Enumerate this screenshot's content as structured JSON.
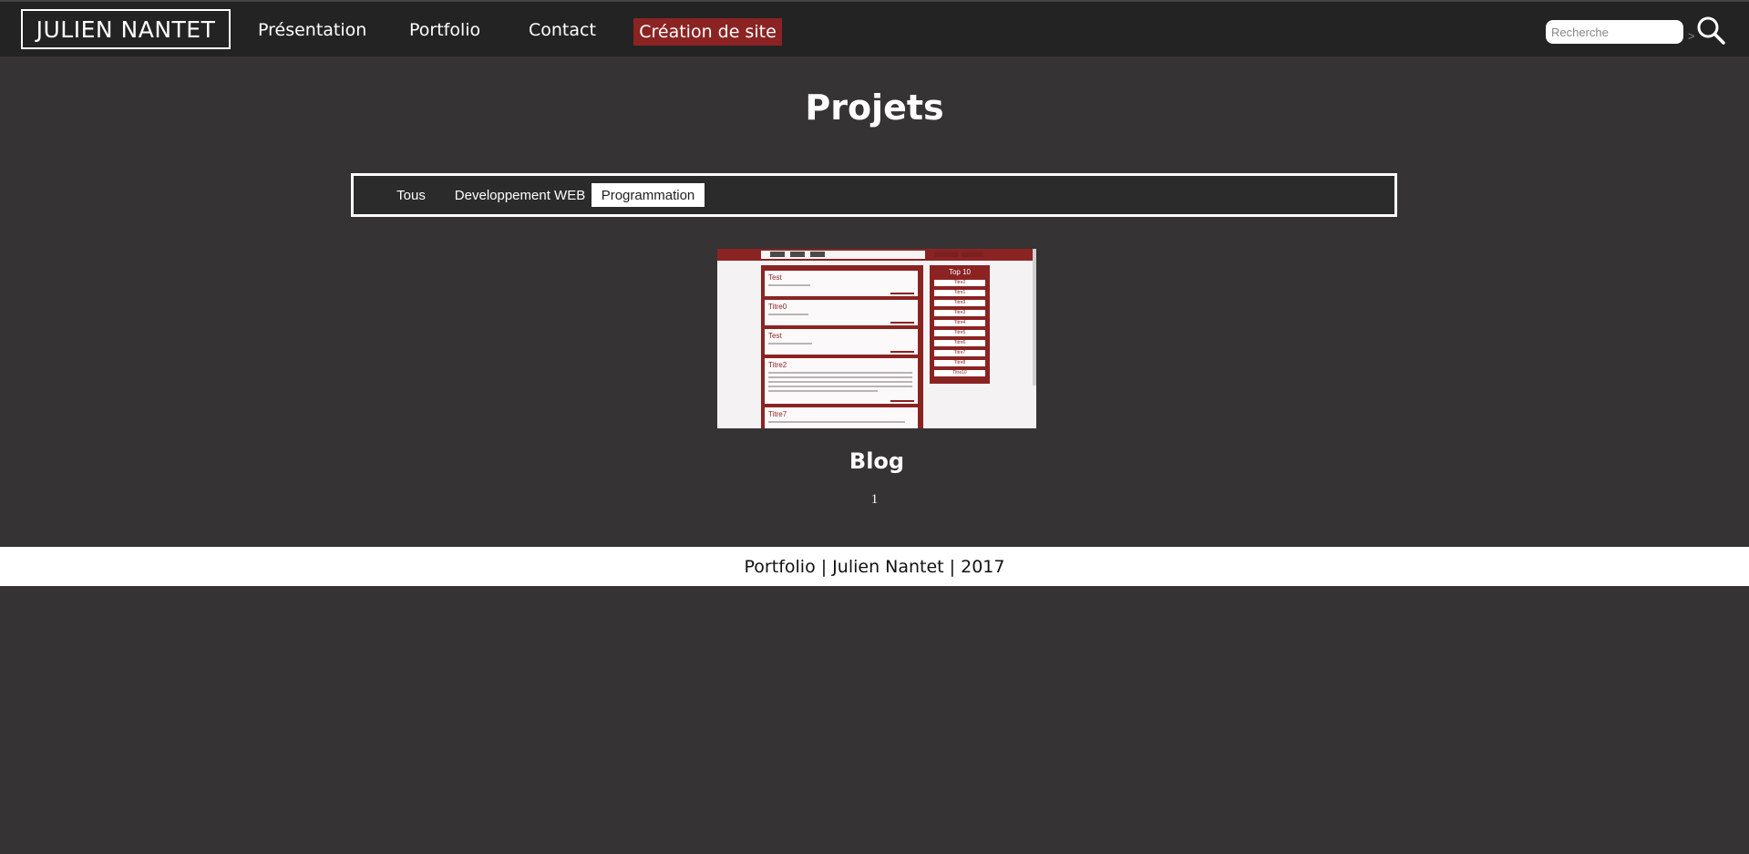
{
  "header": {
    "logo": "JULIEN NANTET",
    "nav": [
      "Présentation",
      "Portfolio",
      "Contact"
    ],
    "highlight": "Création de site",
    "search_placeholder": "Recherche",
    "search_arrow": ">"
  },
  "main": {
    "title": "Projets",
    "filters": [
      "Tous",
      "Developpement WEB",
      "Programmation"
    ],
    "active_filter": "Programmation",
    "project": {
      "title": "Blog",
      "thumbnail": {
        "posts": [
          "Test",
          "Titre0",
          "Test",
          "Titre2",
          "Titre7"
        ],
        "sidebar_title": "Top 10",
        "sidebar_items": [
          "Titre2",
          "Titre1",
          "Titre9",
          "Titre3",
          "Titre4",
          "Titre5",
          "Titre6",
          "Titre7",
          "Titre8",
          "Titre10"
        ]
      }
    },
    "pagination": "1"
  },
  "footer": {
    "text": "Portfolio | Julien Nantet | 2017"
  },
  "colors": {
    "accent": "#8b2323",
    "background": "#353334",
    "navbar": "#232323"
  }
}
